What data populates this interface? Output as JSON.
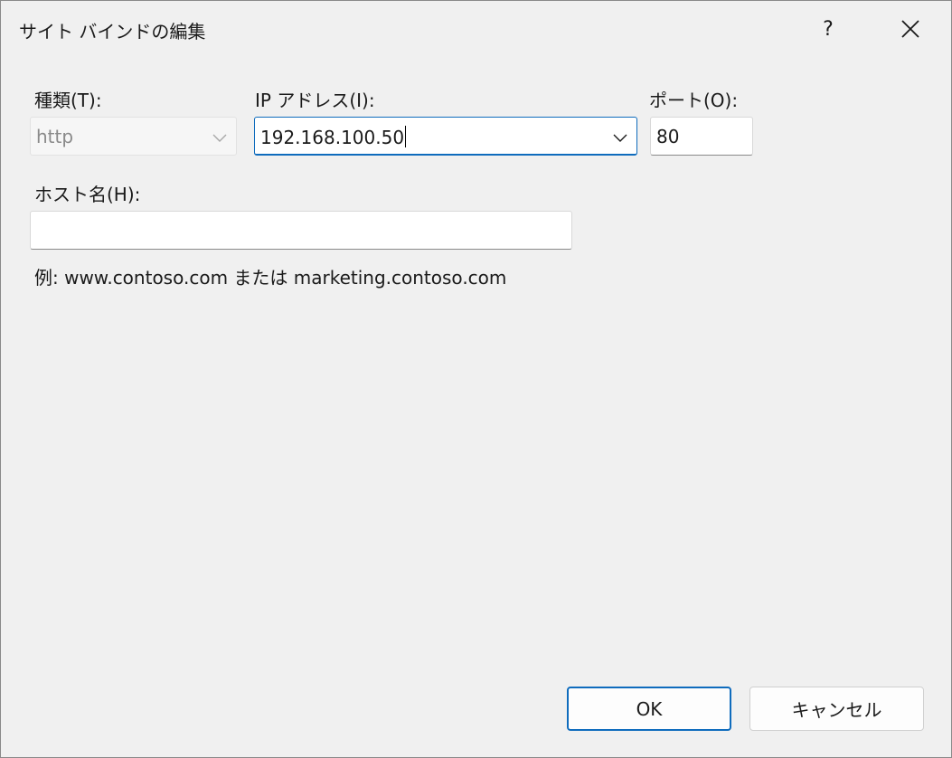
{
  "dialog": {
    "title": "サイト バインドの編集",
    "help_label": "?"
  },
  "type_field": {
    "label": "種類(T):",
    "value": "http"
  },
  "ip_field": {
    "label": "IP アドレス(I):",
    "value": "192.168.100.50"
  },
  "port_field": {
    "label": "ポート(O):",
    "value": "80"
  },
  "host_field": {
    "label": "ホスト名(H):",
    "value": ""
  },
  "hint": "例: www.contoso.com または marketing.contoso.com",
  "buttons": {
    "ok": "OK",
    "cancel": "キャンセル"
  },
  "colors": {
    "accent": "#0f6cbd",
    "background": "#f0f0f0"
  },
  "icons": {
    "close": "close-icon",
    "dropdown": "chevron-down-icon"
  }
}
